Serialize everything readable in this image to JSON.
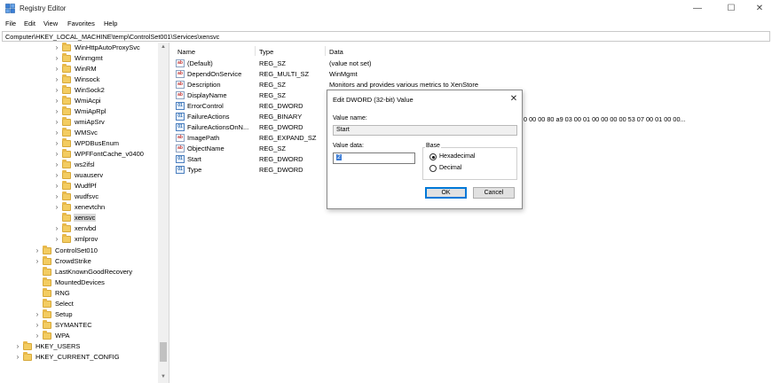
{
  "window": {
    "title": "Registry Editor",
    "controls": {
      "minimize": "—",
      "maximize": "☐",
      "close": "✕"
    }
  },
  "menu": [
    "File",
    "Edit",
    "View",
    "Favorites",
    "Help"
  ],
  "address": "Computer\\HKEY_LOCAL_MACHINE\\temp\\ControlSet001\\Services\\xensvc",
  "tree": {
    "services": [
      "WinHttpAutoProxySvc",
      "Winmgmt",
      "WinRM",
      "Winsock",
      "WinSock2",
      "WmiAcpi",
      "WmiApRpl",
      "wmiApSrv",
      "WMSvc",
      "WPDBusEnum",
      "WPFFontCache_v0400",
      "ws2ifsl",
      "wuauserv",
      "WudfPf",
      "wudfsvc",
      "xenevtchn",
      "xensvc",
      "xenvbd",
      "xmlprov"
    ],
    "selected": "xensvc",
    "temp_children": [
      "ControlSet010",
      "CrowdStrike",
      "LastKnownGoodRecovery",
      "MountedDevices",
      "RNG",
      "Select",
      "Setup",
      "SYMANTEC",
      "WPA"
    ],
    "hives": [
      "HKEY_USERS",
      "HKEY_CURRENT_CONFIG"
    ]
  },
  "columns": {
    "name": "Name",
    "type": "Type",
    "data": "Data"
  },
  "values": [
    {
      "name": "(Default)",
      "type": "REG_SZ",
      "data": "(value not set)",
      "icon": "string-value-icon"
    },
    {
      "name": "DependOnService",
      "type": "REG_MULTI_SZ",
      "data": "WinMgmt",
      "icon": "string-value-icon"
    },
    {
      "name": "Description",
      "type": "REG_SZ",
      "data": "Monitors and provides various metrics to XenStore",
      "icon": "string-value-icon"
    },
    {
      "name": "DisplayName",
      "type": "REG_SZ",
      "data": "",
      "icon": "string-value-icon"
    },
    {
      "name": "ErrorControl",
      "type": "REG_DWORD",
      "data": "",
      "icon": "binary-value-icon"
    },
    {
      "name": "FailureActions",
      "type": "REG_BINARY",
      "data": "",
      "icon": "binary-value-icon"
    },
    {
      "name": "FailureActionsOnN...",
      "type": "REG_DWORD",
      "data": "",
      "icon": "binary-value-icon"
    },
    {
      "name": "ImagePath",
      "type": "REG_EXPAND_SZ",
      "data": "",
      "icon": "string-value-icon"
    },
    {
      "name": "ObjectName",
      "type": "REG_SZ",
      "data": "",
      "icon": "string-value-icon"
    },
    {
      "name": "Start",
      "type": "REG_DWORD",
      "data": "",
      "icon": "binary-value-icon"
    },
    {
      "name": "Type",
      "type": "REG_DWORD",
      "data": "",
      "icon": "binary-value-icon"
    }
  ],
  "failure_actions_overflow": "0 00 00 80 a9 03 00 01 00 00 00 00 53 07 00 01 00 00...",
  "dialog": {
    "title": "Edit DWORD (32-bit) Value",
    "close": "✕",
    "value_name_label": "Value name:",
    "value_name": "Start",
    "value_data_label": "Value data:",
    "value_data": "2",
    "base_label": "Base",
    "radio_hex": "Hexadecimal",
    "radio_dec": "Decimal",
    "base_selected": "Hexadecimal",
    "ok": "OK",
    "cancel": "Cancel"
  }
}
